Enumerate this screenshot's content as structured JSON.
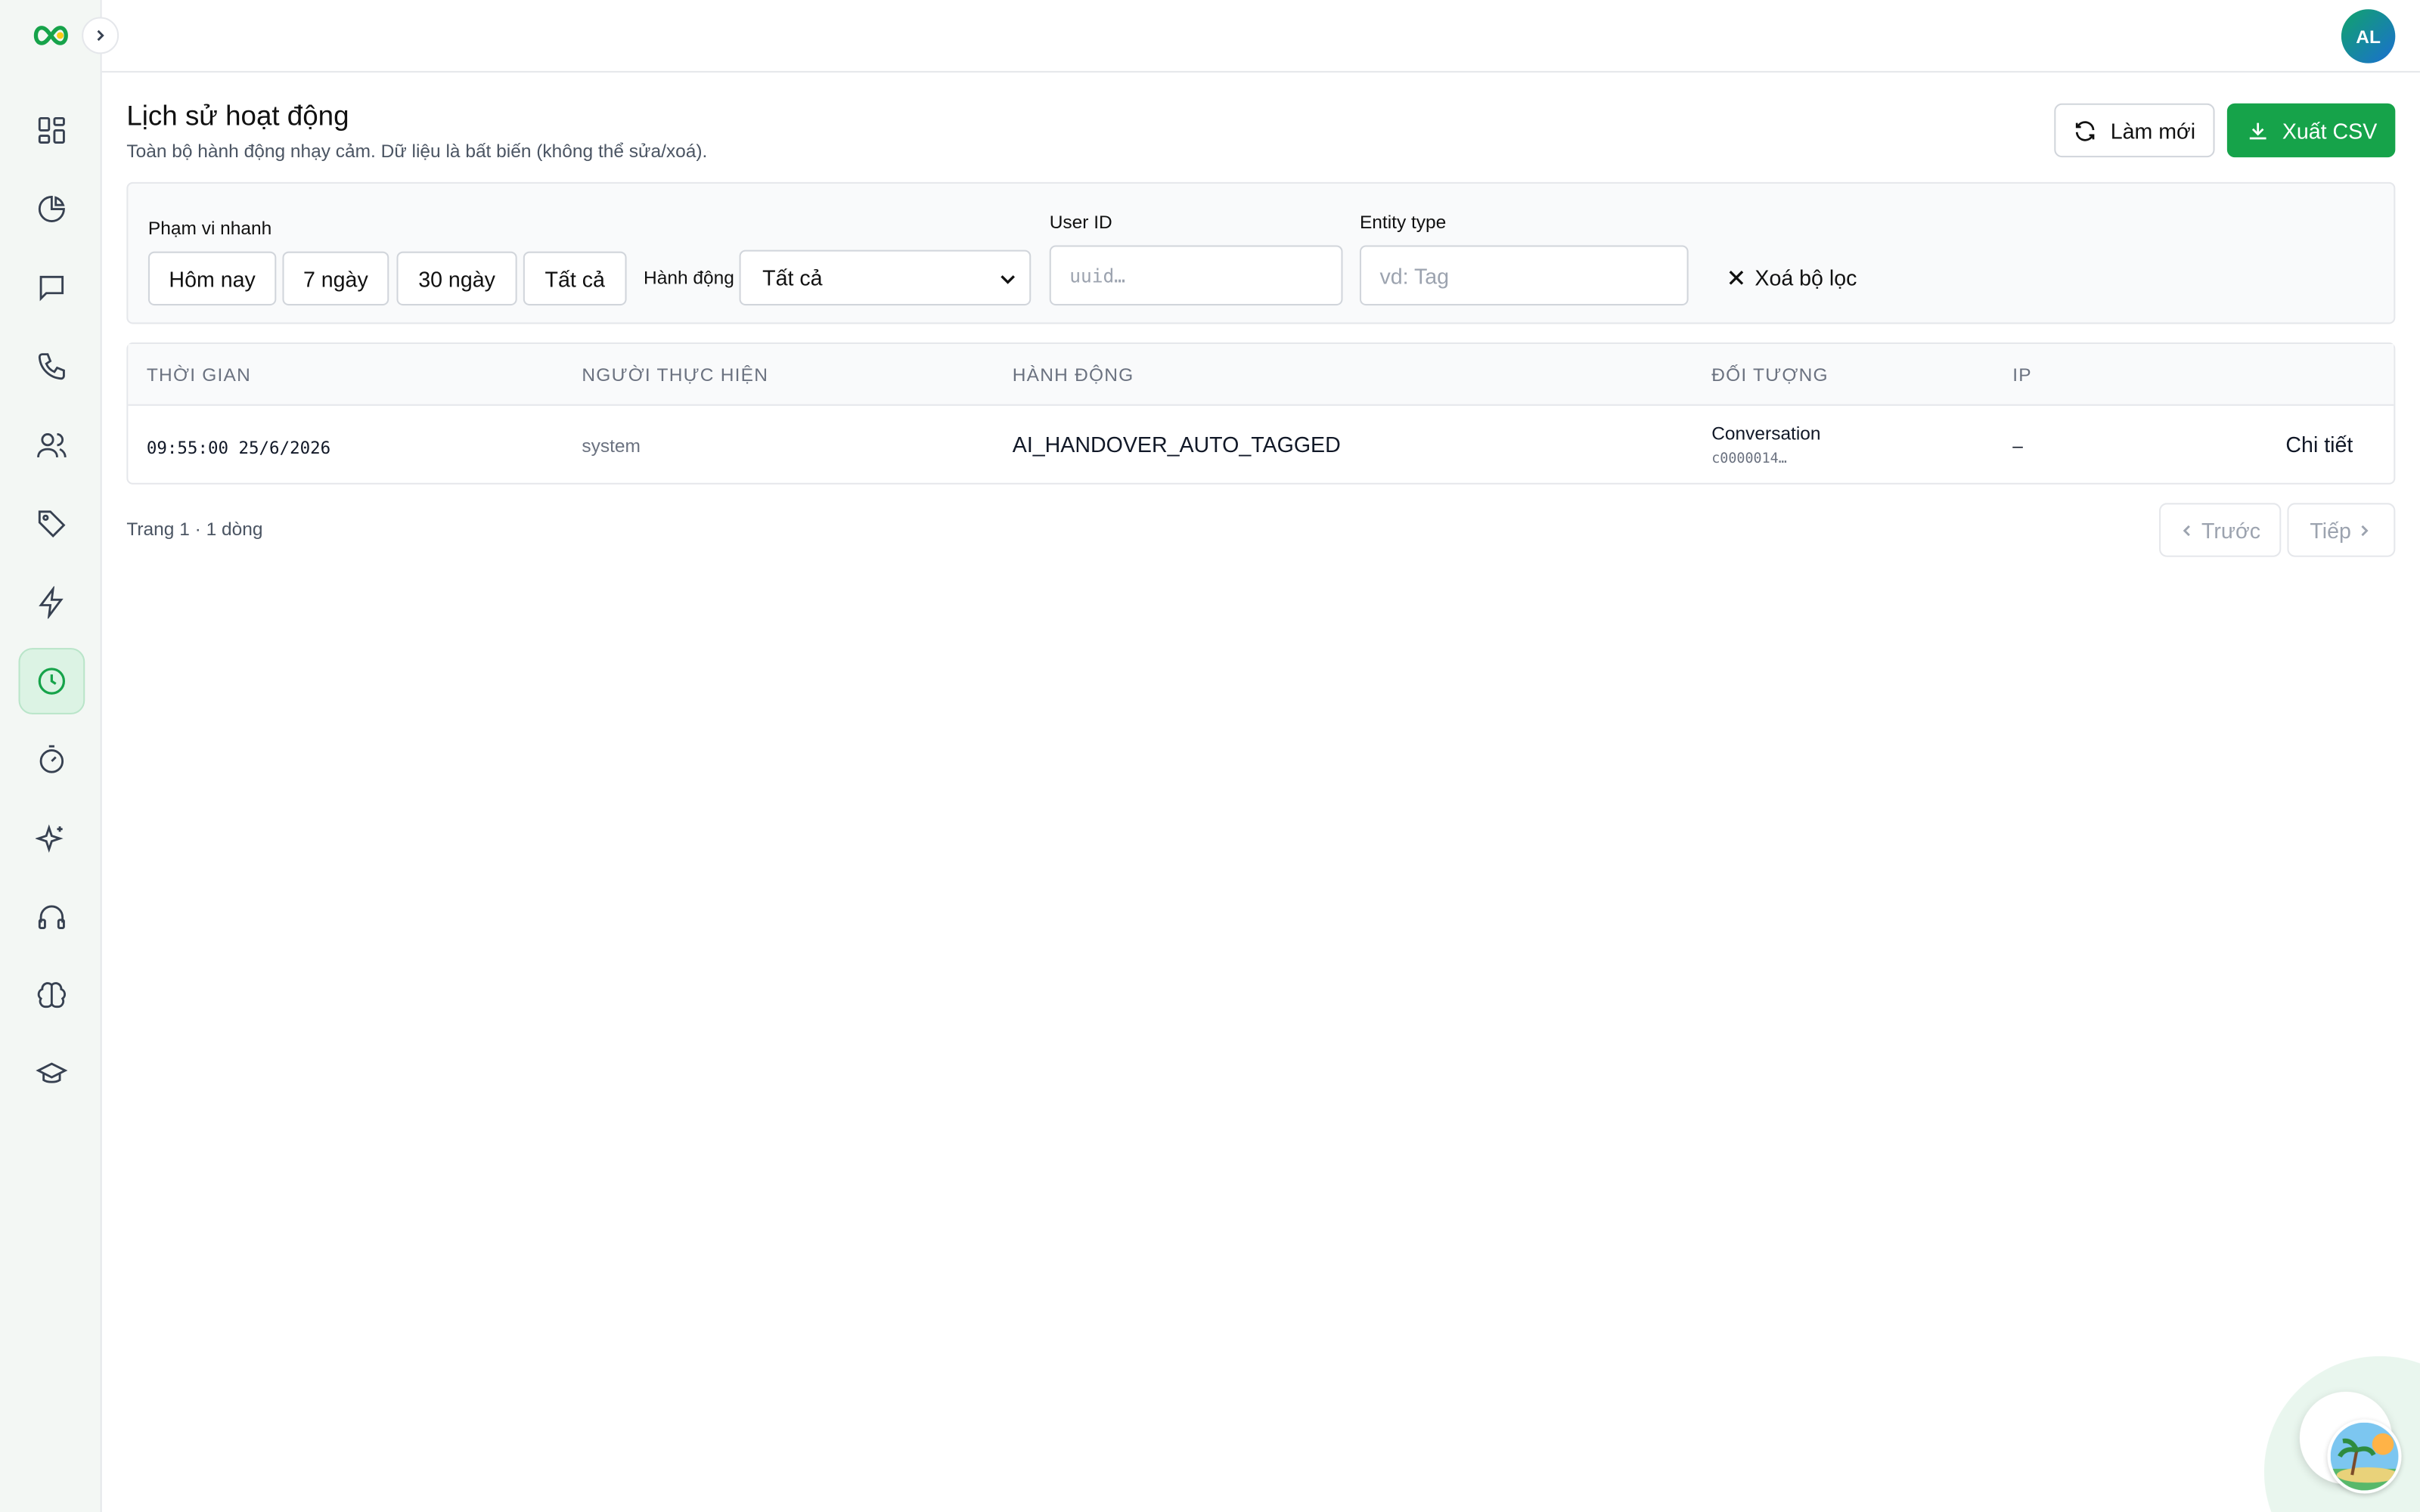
{
  "user": {
    "initials": "AL"
  },
  "header": {
    "title": "Lịch sử hoạt động",
    "subtitle": "Toàn bộ hành động nhạy cảm. Dữ liệu là bất biến (không thể sửa/xoá).",
    "refresh_label": "Làm mới",
    "export_label": "Xuất CSV"
  },
  "sidebar": {
    "items": [
      {
        "icon": "dashboard-icon"
      },
      {
        "icon": "pie-chart-icon"
      },
      {
        "icon": "chat-icon"
      },
      {
        "icon": "phone-icon"
      },
      {
        "icon": "users-icon"
      },
      {
        "icon": "tag-icon"
      },
      {
        "icon": "lightning-icon"
      },
      {
        "icon": "clock-icon",
        "active": true
      },
      {
        "icon": "timer-icon"
      },
      {
        "icon": "sparkles-icon"
      },
      {
        "icon": "headphones-icon"
      },
      {
        "icon": "brain-icon"
      },
      {
        "icon": "graduation-cap-icon"
      }
    ]
  },
  "filters": {
    "quick_range_label": "Phạm vi nhanh",
    "quick_ranges": [
      "Hôm nay",
      "7 ngày",
      "30 ngày",
      "Tất cả"
    ],
    "action_label": "Hành động",
    "action_value": "Tất cả",
    "user_id_label": "User ID",
    "user_id_placeholder": "uuid…",
    "entity_type_label": "Entity type",
    "entity_type_placeholder": "vd: Tag",
    "clear_label": "Xoá bộ lọc"
  },
  "table": {
    "columns": [
      "THỜI GIAN",
      "NGƯỜI THỰC HIỆN",
      "HÀNH ĐỘNG",
      "ĐỐI TƯỢNG",
      "IP"
    ],
    "rows": [
      {
        "time": "09:55:00 25/6/2026",
        "actor": "system",
        "action": "AI_HANDOVER_AUTO_TAGGED",
        "entity_type": "Conversation",
        "entity_id": "c0000014…",
        "ip": "–",
        "detail_label": "Chi tiết"
      }
    ]
  },
  "pagination": {
    "info": "Trang 1 · 1 dòng",
    "prev_label": "Trước",
    "next_label": "Tiếp"
  },
  "colors": {
    "primary": "#16a34a",
    "active_nav_bg": "#dcf3e4",
    "icon": "#374151"
  }
}
